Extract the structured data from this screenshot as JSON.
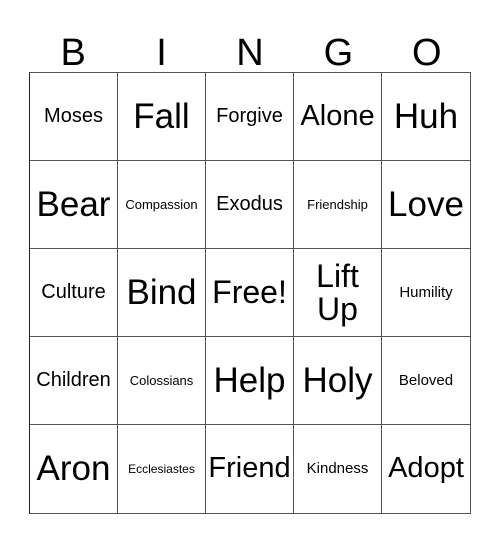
{
  "card": {
    "title": "BINGO",
    "header_letters": [
      "B",
      "I",
      "N",
      "G",
      "O"
    ],
    "colors": {
      "background": "#ffffff",
      "text": "#000000",
      "grid_line": "#555555"
    },
    "grid": {
      "rows": 5,
      "columns": 5,
      "cells": [
        {
          "text": "Moses",
          "size": "m"
        },
        {
          "text": "Fall",
          "size": "xxl"
        },
        {
          "text": "Forgive",
          "size": "m"
        },
        {
          "text": "Alone",
          "size": "l"
        },
        {
          "text": "Huh",
          "size": "xxl"
        },
        {
          "text": "Bear",
          "size": "xxl"
        },
        {
          "text": "Compassion",
          "size": "xs"
        },
        {
          "text": "Exodus",
          "size": "m"
        },
        {
          "text": "Friendship",
          "size": "xs"
        },
        {
          "text": "Love",
          "size": "xxl"
        },
        {
          "text": "Culture",
          "size": "m"
        },
        {
          "text": "Bind",
          "size": "xxl"
        },
        {
          "text": "Free!",
          "size": "xl"
        },
        {
          "text": "Lift Up",
          "size": "xl"
        },
        {
          "text": "Humility",
          "size": "s"
        },
        {
          "text": "Children",
          "size": "m"
        },
        {
          "text": "Colossians",
          "size": "xs"
        },
        {
          "text": "Help",
          "size": "xxl"
        },
        {
          "text": "Holy",
          "size": "xxl"
        },
        {
          "text": "Beloved",
          "size": "s"
        },
        {
          "text": "Aron",
          "size": "xxl"
        },
        {
          "text": "Ecclesiastes",
          "size": "xxs"
        },
        {
          "text": "Friend",
          "size": "l"
        },
        {
          "text": "Kindness",
          "size": "s"
        },
        {
          "text": "Adopt",
          "size": "l"
        }
      ]
    }
  }
}
